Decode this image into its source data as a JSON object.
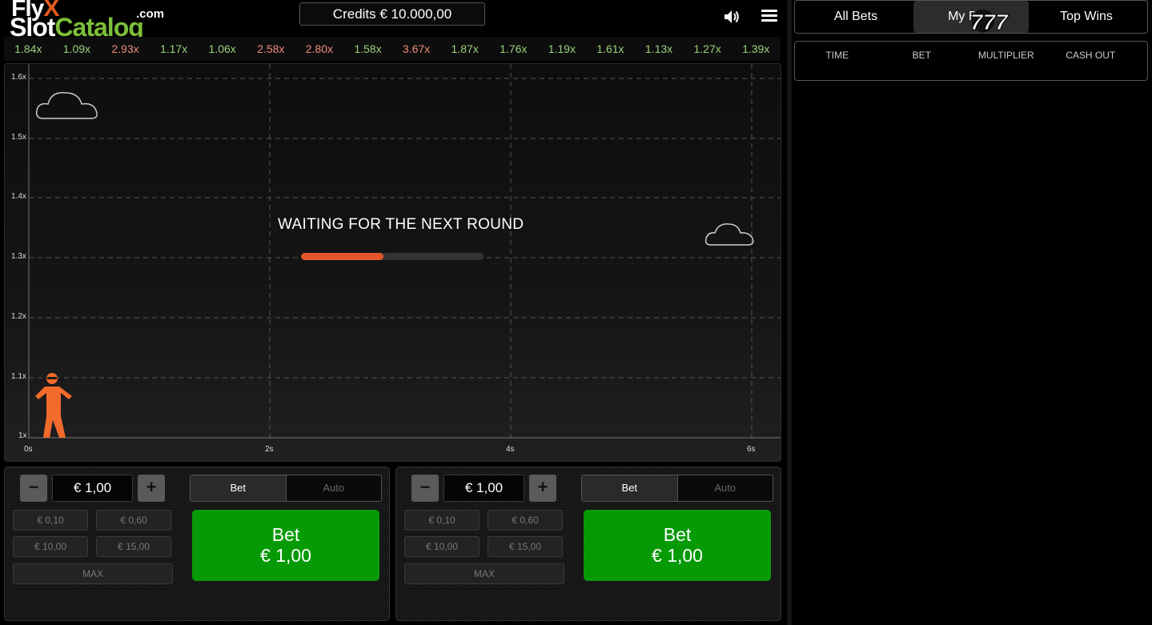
{
  "header": {
    "logo": {
      "fly": "Fly",
      "x": "X",
      "slot": "Slot",
      "catalog": "Catalog",
      "dotcom": ".com"
    },
    "credits": "Credits € 10.000,00"
  },
  "history": [
    {
      "v": "1.84x",
      "c": "green"
    },
    {
      "v": "1.09x",
      "c": "green"
    },
    {
      "v": "2.93x",
      "c": "red"
    },
    {
      "v": "1.17x",
      "c": "green"
    },
    {
      "v": "1.06x",
      "c": "green"
    },
    {
      "v": "2.58x",
      "c": "red"
    },
    {
      "v": "2.80x",
      "c": "red"
    },
    {
      "v": "1.58x",
      "c": "green"
    },
    {
      "v": "3.67x",
      "c": "red"
    },
    {
      "v": "1.87x",
      "c": "green"
    },
    {
      "v": "1.76x",
      "c": "green"
    },
    {
      "v": "1.19x",
      "c": "green"
    },
    {
      "v": "1.61x",
      "c": "green"
    },
    {
      "v": "1.13x",
      "c": "green"
    },
    {
      "v": "1.27x",
      "c": "green"
    },
    {
      "v": "1.39x",
      "c": "green"
    }
  ],
  "graph": {
    "y_labels": [
      "1.6x",
      "1.5x",
      "1.4x",
      "1.3x",
      "1.2x",
      "1.1x",
      "1x"
    ],
    "x_labels": [
      "0s",
      "2s",
      "4s",
      "6s"
    ],
    "waiting_text": "WAITING FOR THE NEXT ROUND",
    "progress_percent": 45
  },
  "panels": [
    {
      "amount": "€ 1,00",
      "minus": "−",
      "plus": "+",
      "mode_bet": "Bet",
      "mode_auto": "Auto",
      "chips": [
        "€ 0,10",
        "€ 0,60",
        "€ 10,00",
        "€ 15,00"
      ],
      "max": "MAX",
      "bet_label": "Bet",
      "bet_amount": "€ 1,00"
    },
    {
      "amount": "€ 1,00",
      "minus": "−",
      "plus": "+",
      "mode_bet": "Bet",
      "mode_auto": "Auto",
      "chips": [
        "€ 0,10",
        "€ 0,60",
        "€ 10,00",
        "€ 15,00"
      ],
      "max": "MAX",
      "bet_label": "Bet",
      "bet_amount": "€ 1,00"
    }
  ],
  "sidebar": {
    "tabs": [
      "All Bets",
      "My Bets",
      "Top Wins"
    ],
    "active_tab": 1,
    "badge": "777",
    "columns": [
      "TIME",
      "BET",
      "MULTIPLIER",
      "CASH OUT"
    ]
  },
  "colors": {
    "accent": "#e5572a",
    "bet_green": "#079a07",
    "history_green": "#9ad17c",
    "history_red": "#ef8c7b"
  },
  "icons": [
    "sound-icon",
    "menu-icon",
    "cloud-icon",
    "pilot-icon"
  ]
}
